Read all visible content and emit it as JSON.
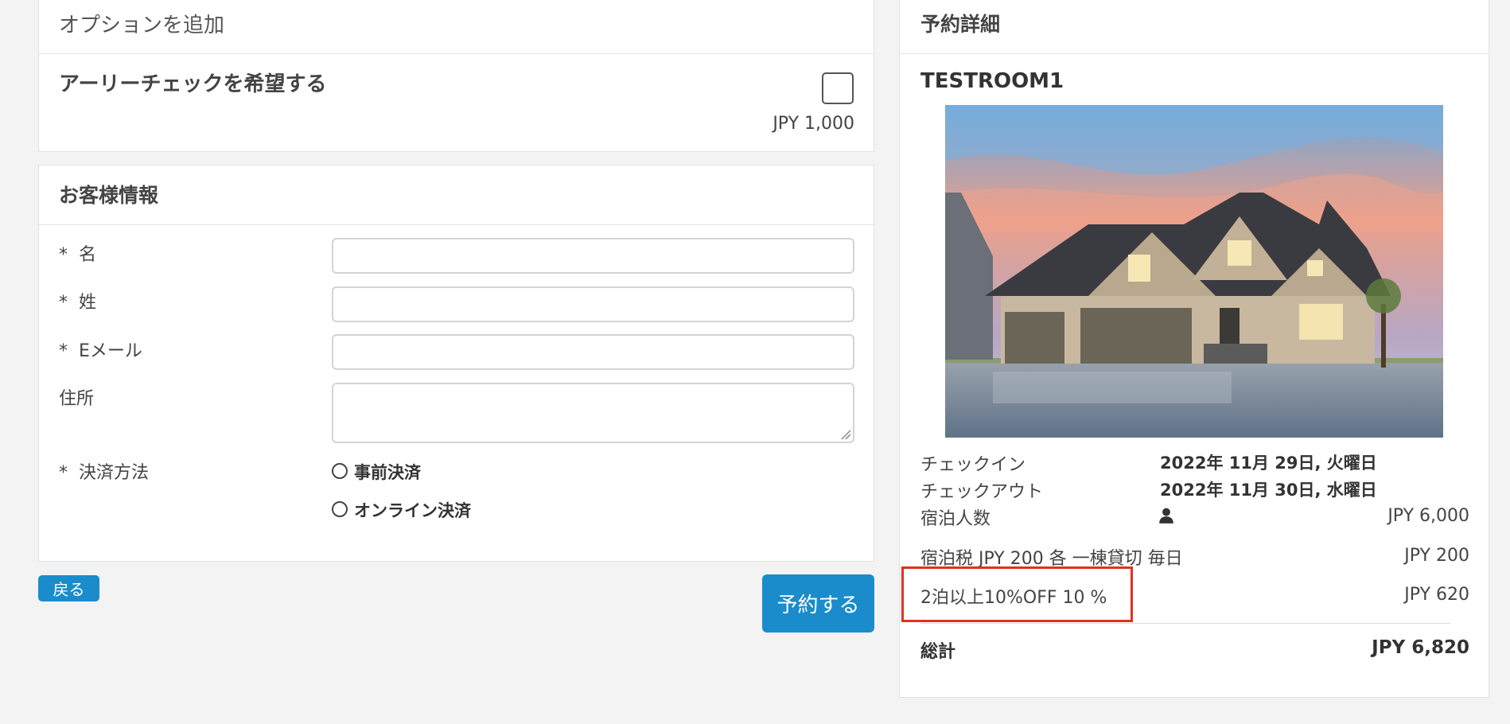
{
  "options": {
    "header": "オプションを追加",
    "early_check": {
      "title": "アーリーチェックを希望する",
      "price": "JPY 1,000"
    }
  },
  "customer": {
    "header": "お客様情報",
    "fields": {
      "first_name": "名",
      "last_name": "姓",
      "email": "Eメール",
      "address": "住所",
      "payment_method": "決済方法"
    },
    "required_mark": "*",
    "payment_options": [
      "事前決済",
      "オンライン決済"
    ]
  },
  "actions": {
    "back": "戻る",
    "reserve": "予約する"
  },
  "details": {
    "header": "予約詳細",
    "room_name": "TESTROOM1",
    "checkin_label": "チェックイン",
    "checkin_value": "2022年 11月 29日, 火曜日",
    "checkout_label": "チェックアウト",
    "checkout_value": "2022年 11月 30日, 水曜日",
    "guests_label": "宿泊人数",
    "guests_price": "JPY 6,000",
    "tax_label": "宿泊税 JPY 200 各 一棟貸切 毎日",
    "tax_price": "JPY 200",
    "discount_label": "2泊以上10%OFF 10 %",
    "discount_price": "JPY 620",
    "total_label": "総計",
    "total_price": "JPY 6,820"
  },
  "icons": {
    "guest": "person-icon"
  },
  "colors": {
    "accent": "#1a8ccc",
    "highlight": "#e0321e"
  }
}
